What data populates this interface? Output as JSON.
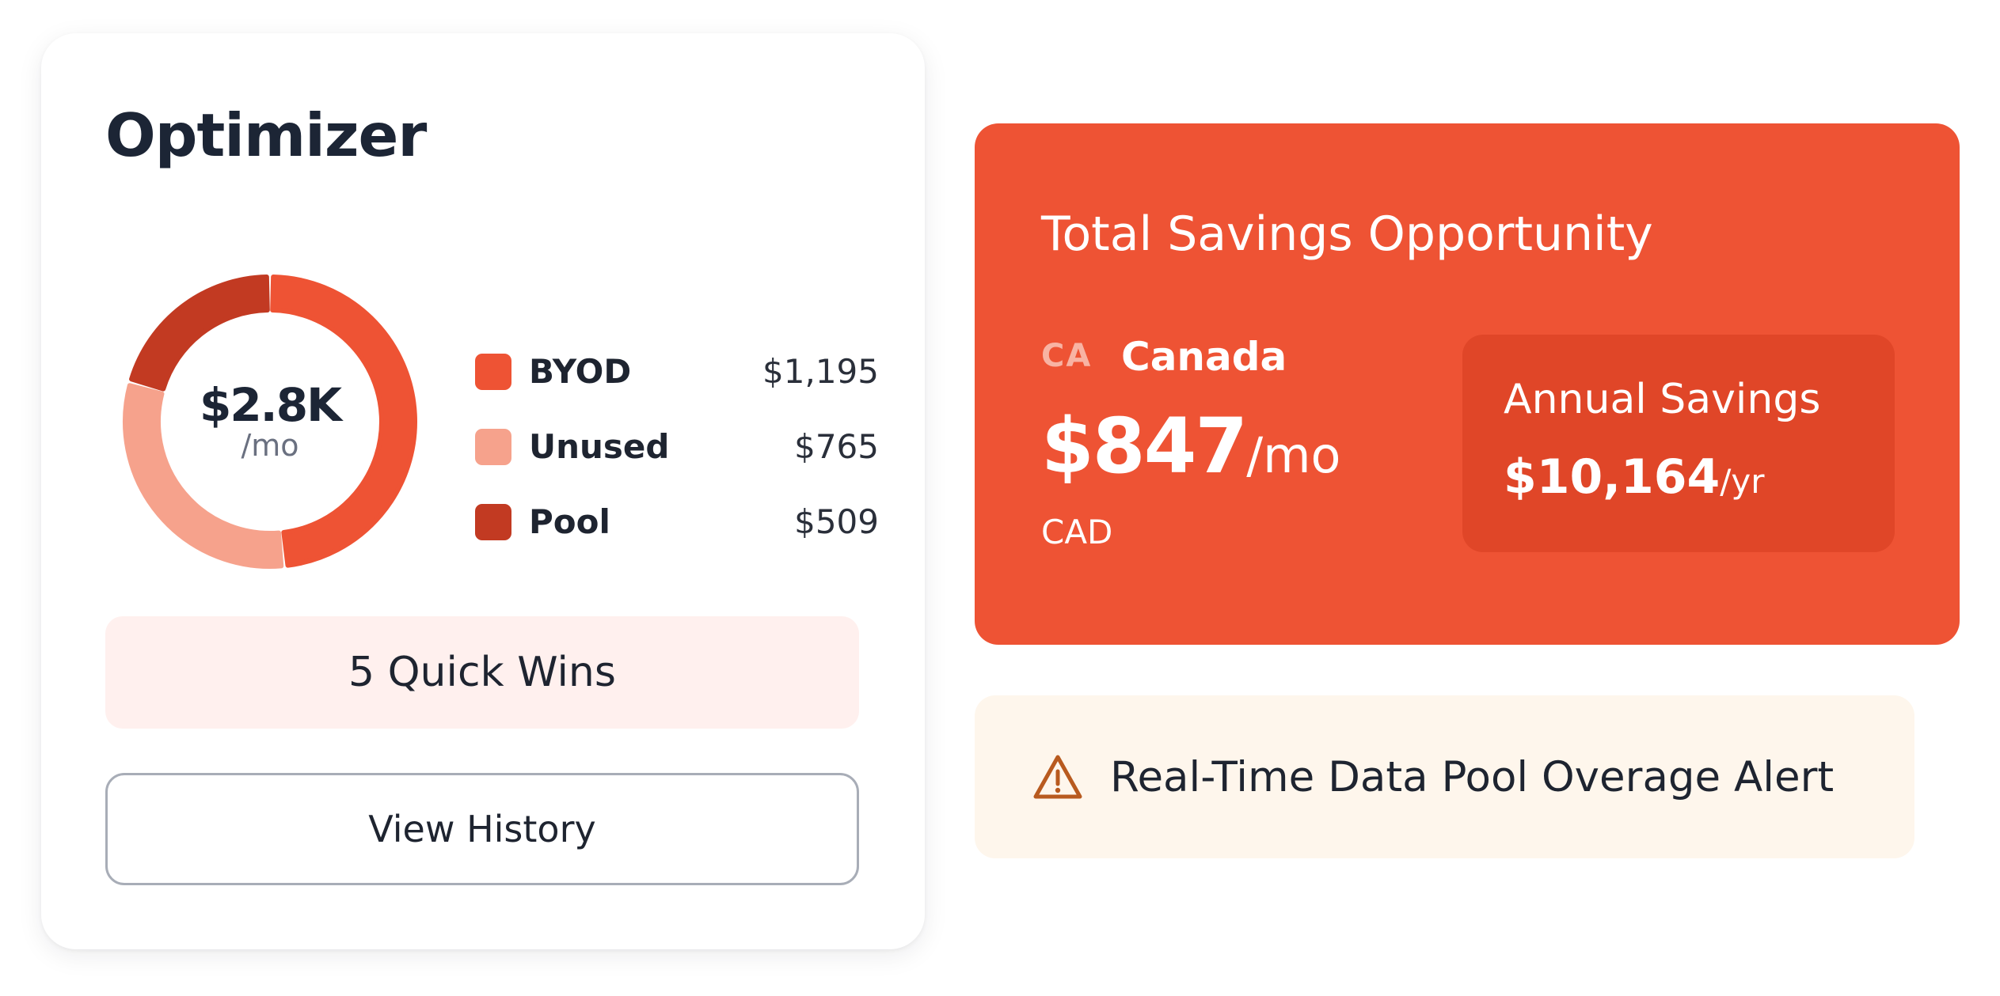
{
  "optimizer": {
    "title": "Optimizer",
    "total_value": "$2.8K",
    "total_unit": "/mo",
    "legend": [
      {
        "label": "BYOD",
        "value": "$1,195",
        "color": "#ee5334"
      },
      {
        "label": "Unused",
        "value": "$765",
        "color": "#f6a28c"
      },
      {
        "label": "Pool",
        "value": "$509",
        "color": "#c23a22"
      }
    ],
    "quick_wins_label": "5 Quick Wins",
    "view_history_label": "View History"
  },
  "chart_data": {
    "type": "pie",
    "categories": [
      "BYOD",
      "Unused",
      "Pool"
    ],
    "values": [
      1195,
      765,
      509
    ],
    "colors": [
      "#ee5334",
      "#f6a28c",
      "#c23a22"
    ]
  },
  "savings": {
    "title": "Total Savings Opportunity",
    "country_code": "CA",
    "country_name": "Canada",
    "monthly_amount": "$847",
    "monthly_unit": "/mo",
    "currency": "CAD",
    "annual_label": "Annual Savings",
    "annual_amount": "$10,164",
    "annual_unit": "/yr",
    "colors": {
      "card": "#ee5334",
      "annual_box": "#e04628"
    }
  },
  "alert": {
    "icon": "warning-icon",
    "text": "Real-Time Data Pool Overage Alert"
  }
}
